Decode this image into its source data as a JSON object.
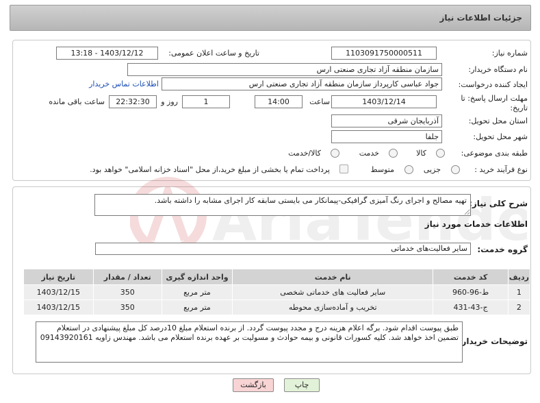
{
  "header": {
    "title": "جزئیات اطلاعات نیاز"
  },
  "form": {
    "need_number_label": "شماره نیاز:",
    "need_number": "1103091750000511",
    "announce_label": "تاریخ و ساعت اعلان عمومی:",
    "announce_value": "1403/12/12 - 13:18",
    "buyer_org_label": "نام دستگاه خریدار:",
    "buyer_org": "سازمان منطقه آزاد تجاری صنعتی ارس",
    "creator_label": "ایجاد کننده درخواست:",
    "creator": "جواد عباسی کارپرداز سازمان منطقه آزاد تجاری صنعتی ارس",
    "contact_link": "اطلاعات تماس خریدار",
    "deadline_label": "مهلت ارسال پاسخ: تا تاریخ:",
    "deadline_date": "1403/12/14",
    "time_label": "ساعت",
    "deadline_time": "14:00",
    "days_value": "1",
    "days_label": "روز و",
    "remaining_time": "22:32:30",
    "remaining_label": "ساعت باقی مانده",
    "province_label": "استان محل تحویل:",
    "province": "آذربایجان شرقی",
    "city_label": "شهر محل تحویل:",
    "city": "جلفا",
    "category_label": "طبقه بندی موضوعی:",
    "category_options": [
      "کالا",
      "خدمت",
      "کالا/خدمت"
    ],
    "process_label": "نوع فرآیند خرید :",
    "process_options": [
      "جزیی",
      "متوسط"
    ],
    "payment_note": "پرداخت تمام یا بخشی از مبلغ خرید،از محل \"اسناد خزانه اسلامی\" خواهد بود."
  },
  "details": {
    "summary_label": "شرح کلی نیاز:",
    "summary": "تهیه مصالح و اجرای رنگ آمیزی گرافیکی-پیمانکار می بایستی سابقه کار اجرای مشابه را داشته باشد.",
    "services_title": "اطلاعات خدمات مورد نیاز",
    "service_group_label": "گروه خدمت:",
    "service_group": "سایر فعالیت‌های خدماتی",
    "table": {
      "headers": [
        "ردیف",
        "کد خدمت",
        "نام خدمت",
        "واحد اندازه گیری",
        "تعداد / مقدار",
        "تاریخ نیاز"
      ],
      "rows": [
        [
          "1",
          "ط-96-960",
          "سایر فعالیت های خدماتی شخصی",
          "متر مربع",
          "350",
          "1403/12/15"
        ],
        [
          "2",
          "ج-43-431",
          "تخریب و آماده‌سازی محوطه",
          "متر مربع",
          "350",
          "1403/12/15"
        ]
      ]
    },
    "buyer_notes_label": "توضیحات خریدار:",
    "buyer_notes": "طبق پیوست اقدام شود. برگه اعلام هزینه درج و مجدد پیوست گردد. از برنده استعلام مبلغ 10درصد کل مبلغ پیشنهادی در استعلام تضمین اخذ خواهد شد. کلیه کسورات قانونی و بیمه حوادث و مسولیت بر عهده برنده استعلام می باشد. مهندس زاویه 09143920161"
  },
  "buttons": {
    "back": "بازگشت",
    "print": "چاپ"
  },
  "watermark": {
    "text": "AriaTender.neT"
  },
  "colors": {
    "header_bg": "#c4c4c4",
    "link": "#1a4db3",
    "back_button_bg": "#f8d4d4",
    "print_button_bg": "#e2f2d8"
  }
}
